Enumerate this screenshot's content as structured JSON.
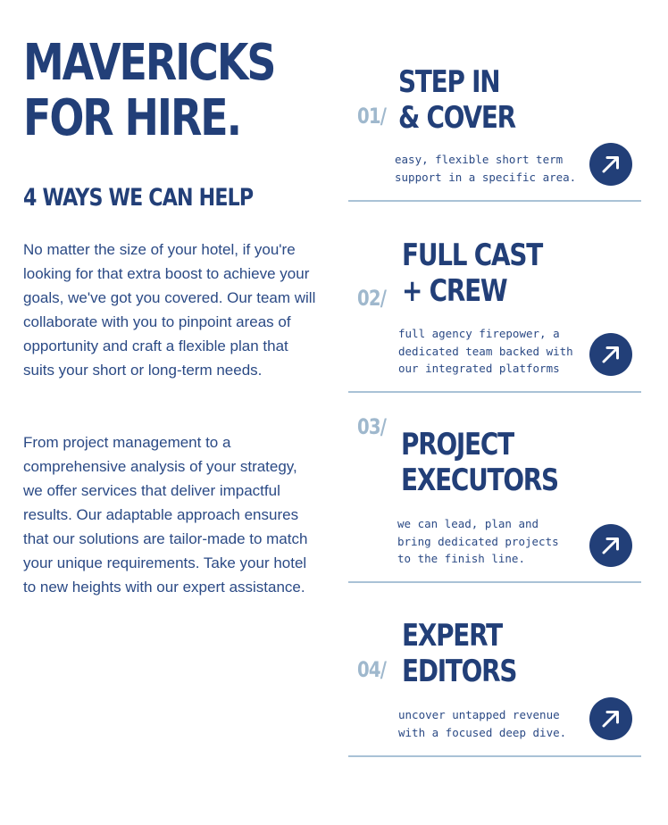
{
  "hero": {
    "title_line1": "MAVERICKS",
    "title_line2": "FOR HIRE.",
    "subtitle": "4 WAYS WE CAN HELP",
    "paragraph1": "No matter the size of your hotel, if you're looking for that extra boost to achieve your goals, we've got you covered. Our team will collaborate with you to pinpoint areas of opportunity and craft a flexible plan that suits your short or long-term needs.",
    "paragraph2": "From project management to a comprehensive analysis of your strategy, we offer services that deliver impactful results. Our adaptable approach ensures that our solutions are tailor-made to match your unique requirements. Take your hotel to new heights with our expert assistance."
  },
  "ways": [
    {
      "number": "01/",
      "title_line1": "STEP IN",
      "title_line2": "& COVER",
      "desc_lines": [
        "easy, flexible short term",
        "support in a specific area."
      ],
      "icon": "arrow-up-right-icon"
    },
    {
      "number": "02/",
      "title_line1": "FULL CAST",
      "title_line2": "+ CREW",
      "desc_lines": [
        "full agency firepower, a",
        "dedicated team backed with",
        "our integrated platforms"
      ],
      "icon": "arrow-up-right-icon"
    },
    {
      "number": "03/",
      "title_line1": "PROJECT",
      "title_line2": "EXECUTORS",
      "desc_lines": [
        "we can lead, plan and",
        "bring dedicated projects",
        "to the finish line."
      ],
      "icon": "arrow-up-right-icon"
    },
    {
      "number": "04/",
      "title_line1": "EXPERT",
      "title_line2": "EDITORS",
      "desc_lines": [
        "uncover untapped revenue",
        "with a focused deep dive."
      ],
      "icon": "arrow-up-right-icon"
    }
  ],
  "colors": {
    "primary": "#223f78",
    "number_muted": "#9fb8cd",
    "divider": "#a9c2d6",
    "background": "#ffffff"
  }
}
